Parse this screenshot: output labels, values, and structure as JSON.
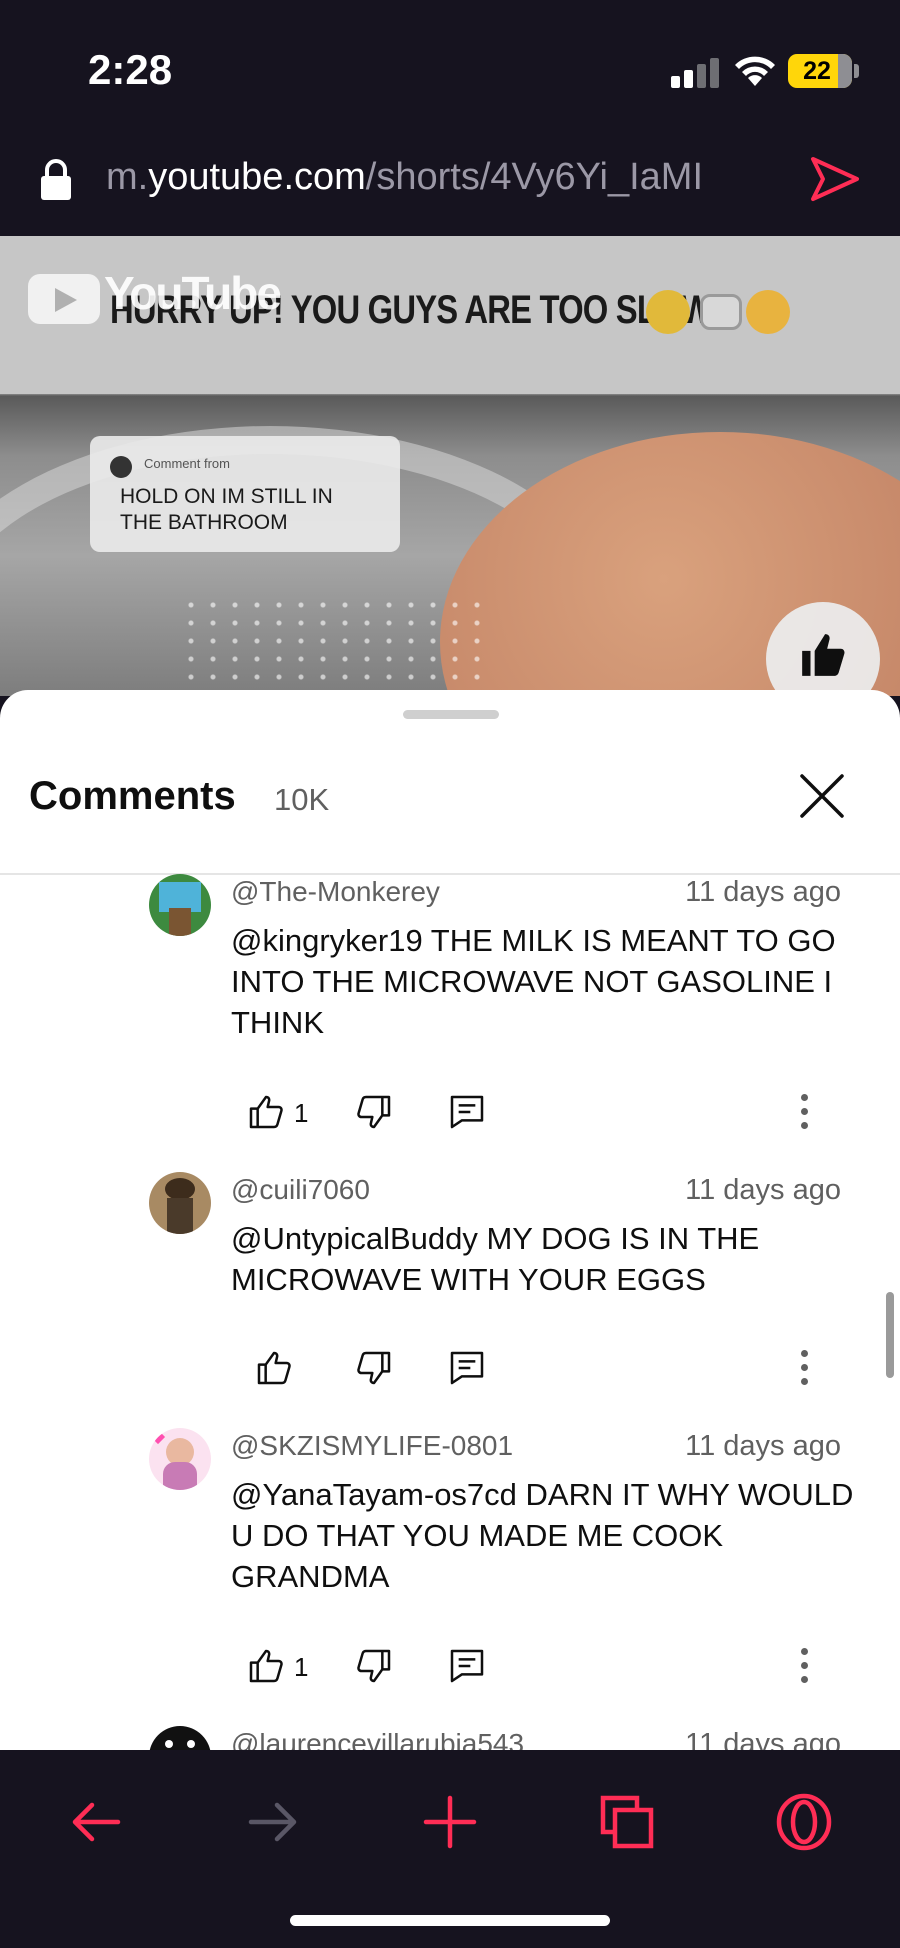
{
  "status_bar": {
    "time": "2:28",
    "battery": "22",
    "battery_color": "#ffd60a"
  },
  "browser": {
    "url_prefix": "m.",
    "url_domain": "youtube.com",
    "url_path": "/shorts/4Vy6Yi_IaMI",
    "accent_color": "#ff2d55"
  },
  "video": {
    "logo_text": "YouTube",
    "caption": "HURRY UP! YOU GUYS ARE TOO SLOW",
    "reply_from": "Comment from",
    "reply_text": "HOLD ON IM STILL IN THE BATHROOM"
  },
  "comments_panel": {
    "title": "Comments",
    "count": "10K",
    "comments": [
      {
        "author": "@The-Monkerey",
        "date": "11 days ago",
        "text": "@kingryker19 THE MILK IS MEANT TO GO INTO THE MICROWAVE NOT GASOLINE I THINK",
        "likes": "1"
      },
      {
        "author": "@cuili7060",
        "date": "11 days ago",
        "text": "@UntypicalBuddy MY DOG IS IN THE MICROWAVE WITH YOUR EGGS",
        "likes": ""
      },
      {
        "author": "@SKZISMYLIFE-0801",
        "date": "11 days ago",
        "text": "@YanaTayam-os7cd DARN IT WHY WOULD U DO THAT YOU MADE ME COOK GRANDMA",
        "likes": "1"
      },
      {
        "author": "@laurencevillarubia543",
        "date": "11 days ago",
        "text": "",
        "likes": ""
      }
    ]
  },
  "icons": {
    "back": "arrow-left-icon",
    "forward": "arrow-right-icon",
    "new_tab": "plus-icon",
    "tabs": "tabs-icon",
    "menu": "opera-icon"
  }
}
